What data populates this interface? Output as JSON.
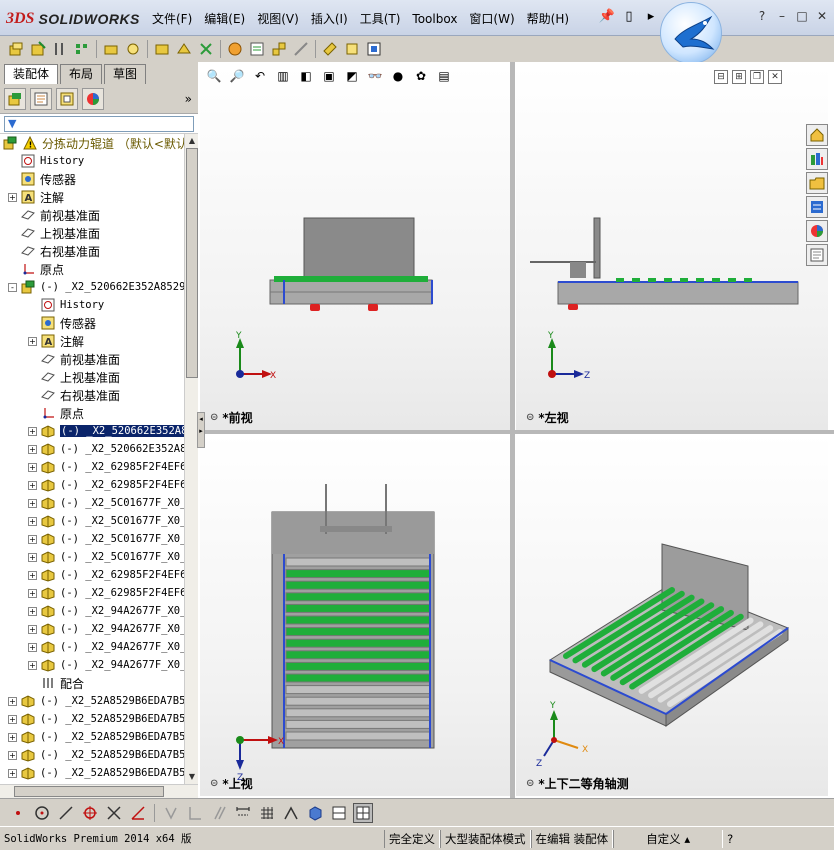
{
  "app": {
    "brand": "SOLIDWORKS",
    "brand_prefix": "3DS"
  },
  "menu": [
    "文件(F)",
    "编辑(E)",
    "视图(V)",
    "插入(I)",
    "工具(T)",
    "Toolbox",
    "窗口(W)",
    "帮助(H)"
  ],
  "panel_tabs": [
    "装配体",
    "布局",
    "草图"
  ],
  "tree": {
    "root": "分拣动力辊道 （默认<默认_",
    "items": [
      {
        "label": "History",
        "icon": "history-icon",
        "level": 1
      },
      {
        "label": "传感器",
        "icon": "sensor-icon",
        "level": 1
      },
      {
        "label": "注解",
        "icon": "annotation-icon",
        "level": 1,
        "expand": "+"
      },
      {
        "label": "前视基准面",
        "icon": "plane-icon",
        "level": 1
      },
      {
        "label": "上视基准面",
        "icon": "plane-icon",
        "level": 1
      },
      {
        "label": "右视基准面",
        "icon": "plane-icon",
        "level": 1
      },
      {
        "label": "原点",
        "icon": "origin-icon",
        "level": 1
      },
      {
        "label": "(-) _X2_520662E352A8529",
        "icon": "subassembly-icon",
        "level": 1,
        "expand": "-"
      },
      {
        "label": "History",
        "icon": "history-icon",
        "level": 2
      },
      {
        "label": "传感器",
        "icon": "sensor-icon",
        "level": 2
      },
      {
        "label": "注解",
        "icon": "annotation-icon",
        "level": 2,
        "expand": "+"
      },
      {
        "label": "前视基准面",
        "icon": "plane-icon",
        "level": 2
      },
      {
        "label": "上视基准面",
        "icon": "plane-icon",
        "level": 2
      },
      {
        "label": "右视基准面",
        "icon": "plane-icon",
        "level": 2
      },
      {
        "label": "原点",
        "icon": "origin-icon",
        "level": 2
      },
      {
        "label": "(-) _X2_520662E352A8",
        "icon": "part-icon",
        "level": 2,
        "expand": "+",
        "selected": true
      },
      {
        "label": "(-) _X2_520662E352A8",
        "icon": "part-icon",
        "level": 2,
        "expand": "+"
      },
      {
        "label": "(-) _X2_62985F2F4EF6",
        "icon": "part-icon",
        "level": 2,
        "expand": "+"
      },
      {
        "label": "(-) _X2_62985F2F4EF6",
        "icon": "part-icon",
        "level": 2,
        "expand": "+"
      },
      {
        "label": "(-) _X2_5C01677F_X0_",
        "icon": "part-icon",
        "level": 2,
        "expand": "+"
      },
      {
        "label": "(-) _X2_5C01677F_X0_",
        "icon": "part-icon",
        "level": 2,
        "expand": "+"
      },
      {
        "label": "(-) _X2_5C01677F_X0_",
        "icon": "part-icon",
        "level": 2,
        "expand": "+"
      },
      {
        "label": "(-) _X2_5C01677F_X0_",
        "icon": "part-icon",
        "level": 2,
        "expand": "+"
      },
      {
        "label": "(-) _X2_62985F2F4EF6",
        "icon": "part-icon",
        "level": 2,
        "expand": "+"
      },
      {
        "label": "(-) _X2_62985F2F4EF6",
        "icon": "part-icon",
        "level": 2,
        "expand": "+"
      },
      {
        "label": "(-) _X2_94A2677F_X0_",
        "icon": "part-icon",
        "level": 2,
        "expand": "+"
      },
      {
        "label": "(-) _X2_94A2677F_X0_",
        "icon": "part-icon",
        "level": 2,
        "expand": "+"
      },
      {
        "label": "(-) _X2_94A2677F_X0_",
        "icon": "part-icon",
        "level": 2,
        "expand": "+"
      },
      {
        "label": "(-) _X2_94A2677F_X0_",
        "icon": "part-icon",
        "level": 2,
        "expand": "+"
      },
      {
        "label": "配合",
        "icon": "mates-icon",
        "level": 2
      },
      {
        "label": "(-) _X2_52A8529B6EDA7B5",
        "icon": "part-icon",
        "level": 1,
        "expand": "+"
      },
      {
        "label": "(-) _X2_52A8529B6EDA7B5",
        "icon": "part-icon",
        "level": 1,
        "expand": "+"
      },
      {
        "label": "(-) _X2_52A8529B6EDA7B5",
        "icon": "part-icon",
        "level": 1,
        "expand": "+"
      },
      {
        "label": "(-) _X2_52A8529B6EDA7B5",
        "icon": "part-icon",
        "level": 1,
        "expand": "+"
      },
      {
        "label": "(-) _X2_52A8529B6EDA7B5",
        "icon": "part-icon",
        "level": 1,
        "expand": "+"
      }
    ]
  },
  "views": {
    "front": "*前视",
    "left": "*左视",
    "top": "*上视",
    "iso": "*上下二等角轴测"
  },
  "axes": {
    "x": "X",
    "y": "Y",
    "z": "Z"
  },
  "status": {
    "version": "SolidWorks Premium 2014 x64 版",
    "defined": "完全定义",
    "mode": "大型装配体模式",
    "editing": "在编辑 装配体",
    "custom": "自定义"
  },
  "colors": {
    "accent_green": "#1fae3a",
    "frame_gray": "#8c8c8c",
    "selection": "#0a246a"
  }
}
